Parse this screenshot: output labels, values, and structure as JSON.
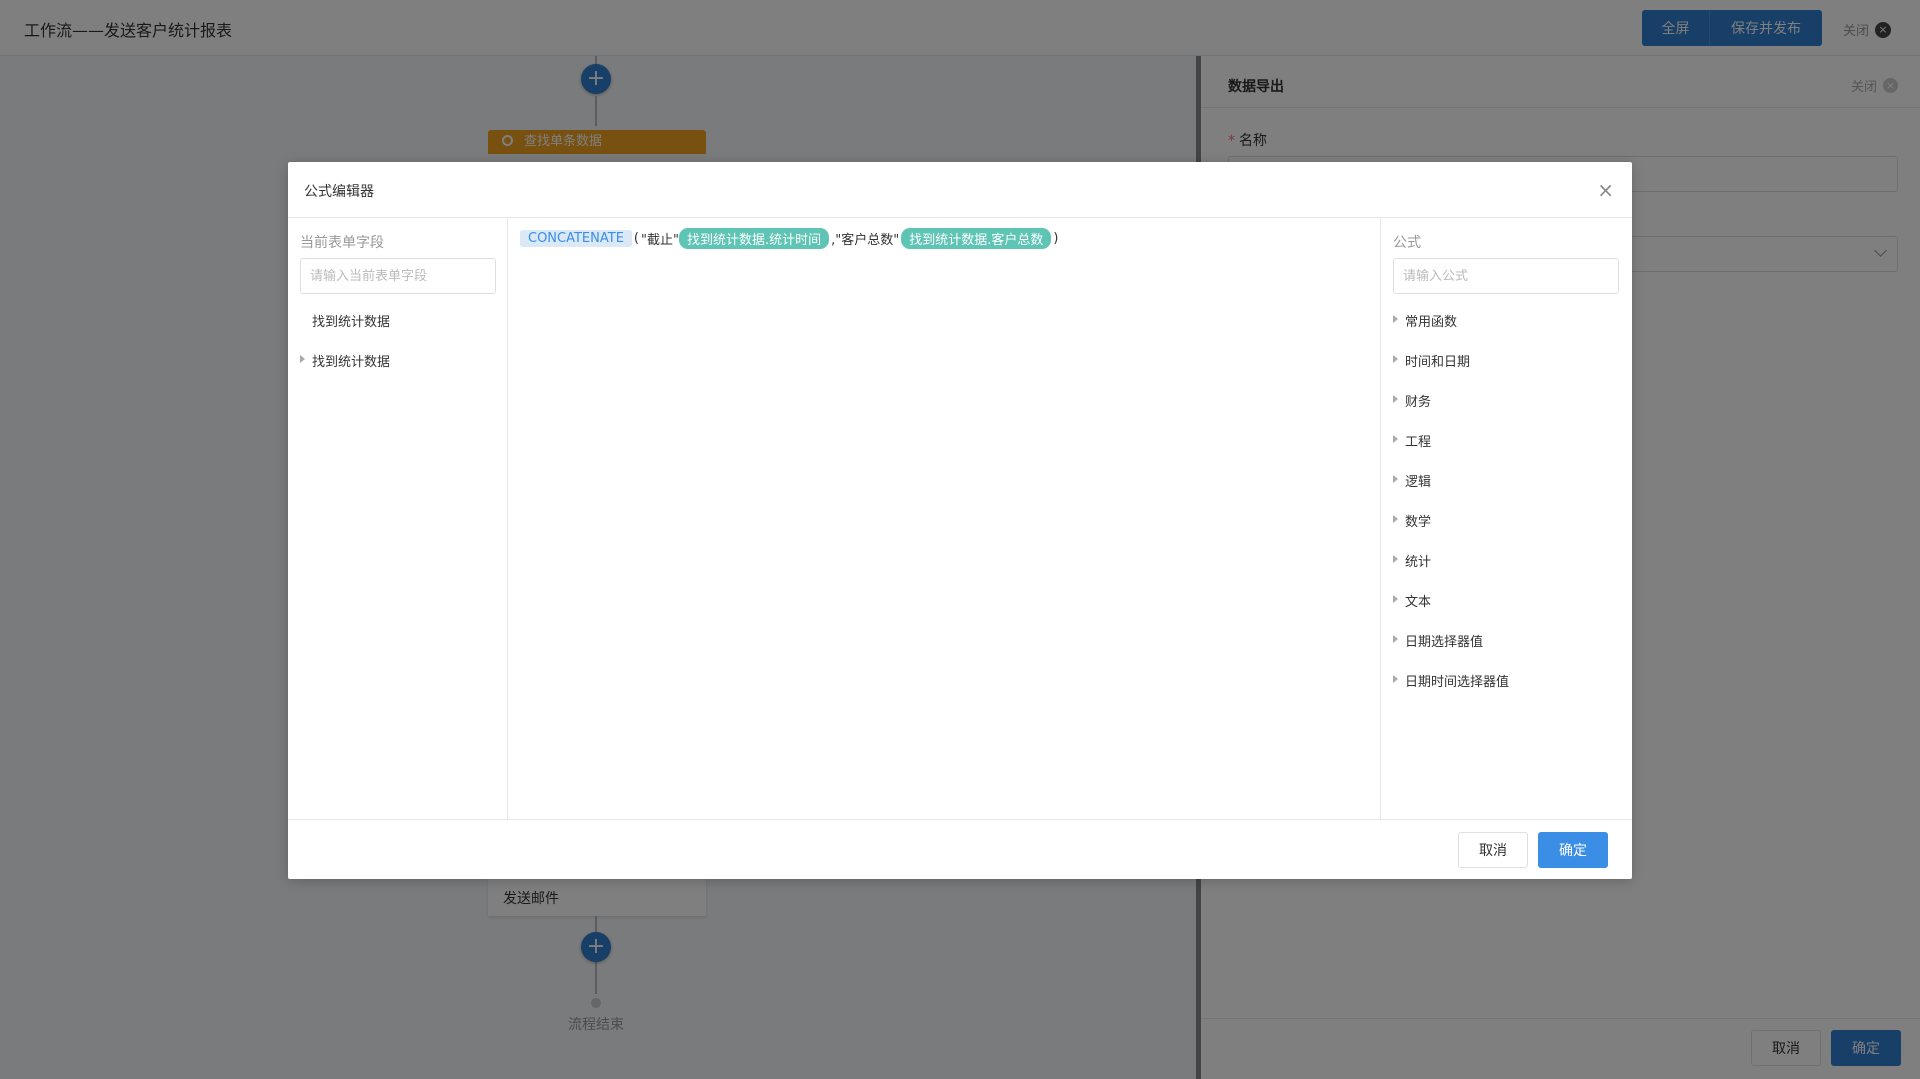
{
  "header": {
    "title": "工作流——发送客户统计报表",
    "fullscreen_label": "全屏",
    "save_publish_label": "保存并发布",
    "close_label": "关闭"
  },
  "flow": {
    "node_title": "查找单条数据",
    "email_node_label": "发送邮件",
    "end_label": "流程结束"
  },
  "side_panel": {
    "title": "数据导出",
    "close_label": "关闭",
    "name_required_mark": "*",
    "name_label": "名称",
    "cancel_label": "取消",
    "ok_label": "确定"
  },
  "modal": {
    "title": "公式编辑器",
    "close_glyph": "×",
    "left_column": {
      "title": "当前表单字段",
      "search_placeholder": "请输入当前表单字段",
      "items": [
        {
          "label": "找到统计数据",
          "has_children": false
        },
        {
          "label": "找到统计数据",
          "has_children": true
        }
      ]
    },
    "formula": {
      "function_name": "CONCATENATE",
      "open_paren": "(",
      "text1": "\"截止\"",
      "field1": "找到统计数据.统计时间",
      "text2": ",\"客户总数\"",
      "field2": "找到统计数据.客户总数",
      "close_paren": ")"
    },
    "right_column": {
      "title": "公式",
      "search_placeholder": "请输入公式",
      "categories": [
        "常用函数",
        "时间和日期",
        "财务",
        "工程",
        "逻辑",
        "数学",
        "统计",
        "文本",
        "日期选择器值",
        "日期时间选择器值"
      ]
    },
    "footer": {
      "cancel_label": "取消",
      "ok_label": "确定"
    }
  },
  "colors": {
    "primary": "#3a8ee6",
    "node_orange": "#f0a020",
    "field_tag": "#5ec4b4"
  }
}
